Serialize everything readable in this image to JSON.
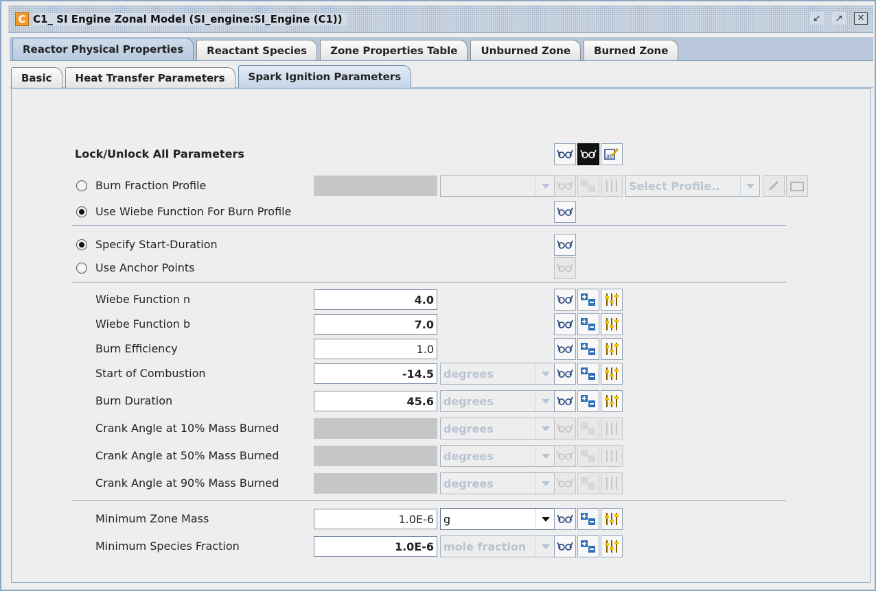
{
  "window": {
    "title": "C1_ SI Engine Zonal Model  (SI_engine:SI_Engine (C1))",
    "icon_letter": "C",
    "buttons": [
      "restore-icon",
      "maximize-icon",
      "close-icon"
    ]
  },
  "tabs_top": [
    {
      "label": "Reactor Physical Properties",
      "active": true
    },
    {
      "label": "Reactant Species",
      "active": false
    },
    {
      "label": "Zone Properties Table",
      "active": false
    },
    {
      "label": "Unburned Zone",
      "active": false
    },
    {
      "label": "Burned Zone",
      "active": false
    }
  ],
  "tabs_sub": [
    {
      "label": "Basic",
      "active": false
    },
    {
      "label": "Heat Transfer Parameters",
      "active": false
    },
    {
      "label": "Spark Ignition Parameters",
      "active": true
    }
  ],
  "lock_all": {
    "label": "Lock/Unlock All Parameters"
  },
  "burn_profile": {
    "profile_radio": "Burn Fraction Profile",
    "wiebe_radio": "Use Wiebe Function For Burn Profile",
    "select_profile_placeholder": "Select Profile..",
    "selected": "wiebe"
  },
  "duration_mode": {
    "start_duration": "Specify Start-Duration",
    "anchor_points": "Use Anchor Points",
    "selected": "start_duration"
  },
  "params": [
    {
      "label": "Wiebe Function n",
      "value": "4.0",
      "bold": true,
      "unit": null
    },
    {
      "label": "Wiebe Function b",
      "value": "7.0",
      "bold": true,
      "unit": null
    },
    {
      "label": "Burn Efficiency",
      "value": "1.0",
      "bold": false,
      "unit": null
    },
    {
      "label": "Start of Combustion",
      "value": "-14.5",
      "bold": true,
      "unit": "degrees"
    },
    {
      "label": "Burn Duration",
      "value": "45.6",
      "bold": true,
      "unit": "degrees"
    },
    {
      "label": "Crank Angle at 10% Mass Burned",
      "value": "",
      "bold": false,
      "unit": "degrees",
      "disabled": true
    },
    {
      "label": "Crank Angle at 50% Mass Burned",
      "value": "",
      "bold": false,
      "unit": "degrees",
      "disabled": true
    },
    {
      "label": "Crank Angle at 90% Mass Burned",
      "value": "",
      "bold": false,
      "unit": "degrees",
      "disabled": true
    }
  ],
  "min_zone_mass": {
    "label": "Minimum Zone Mass",
    "value": "1.0E-6",
    "unit": "g"
  },
  "min_species_fraction": {
    "label": "Minimum Species Fraction",
    "value": "1.0E-6",
    "unit": "mole fraction"
  }
}
